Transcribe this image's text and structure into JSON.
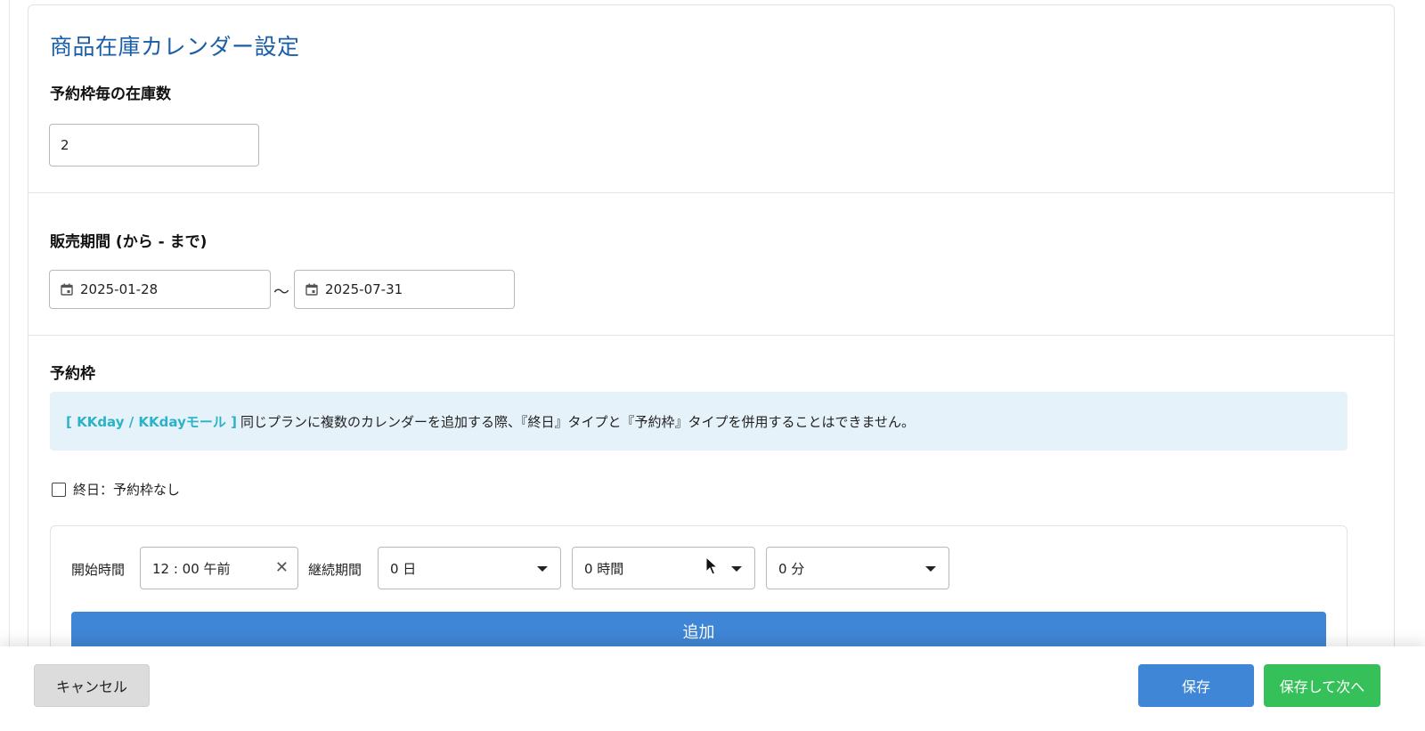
{
  "page_title": "商品在庫カレンダー設定",
  "stock": {
    "label": "予約枠毎の在庫数",
    "value": "2"
  },
  "sales_period": {
    "label": "販売期間 (から - まで)",
    "start": "2025-01-28",
    "separator": "〜",
    "end": "2025-07-31"
  },
  "slots": {
    "label": "予約枠",
    "notice_tag": "[ KKday / KKdayモール ]",
    "notice_text": "同じプランに複数のカレンダーを追加する際、『終日』タイプと『予約枠』タイプを併用することはできません。",
    "all_day_label": "終日：予約枠なし",
    "all_day_checked": false,
    "start_time_label": "開始時間",
    "start_time_value": "12 : 00 午前",
    "duration_label": "継続期間",
    "duration_days": "0 日",
    "duration_hours": "0 時間",
    "duration_minutes": "0 分",
    "add_label": "追加"
  },
  "footer": {
    "cancel_label": "キャンセル",
    "save_label": "保存",
    "save_next_label": "保存して次へ"
  },
  "colors": {
    "title": "#1b5ea8",
    "primary": "#3f86d6",
    "success": "#36c05a",
    "notice_bg": "#e6f2fa",
    "notice_tag": "#2bb2c9"
  }
}
